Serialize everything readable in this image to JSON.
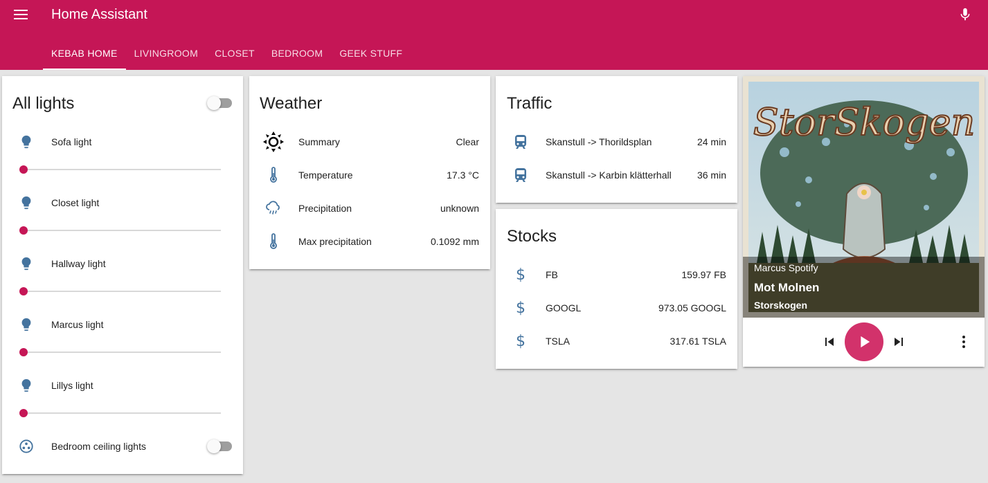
{
  "app": {
    "title": "Home Assistant"
  },
  "tabs": [
    {
      "label": "KEBAB HOME",
      "active": true
    },
    {
      "label": "LIVINGROOM"
    },
    {
      "label": "CLOSET"
    },
    {
      "label": "BEDROOM"
    },
    {
      "label": "GEEK STUFF"
    }
  ],
  "colors": {
    "accent": "#c51656",
    "icon": "#44739e",
    "background": "#e5e5e5"
  },
  "lights": {
    "title": "All lights",
    "items": [
      {
        "label": "Sofa light",
        "icon": "lightbulb-icon",
        "brightness": 0
      },
      {
        "label": "Closet light",
        "icon": "lightbulb-icon",
        "brightness": 0
      },
      {
        "label": "Hallway light",
        "icon": "lightbulb-icon",
        "brightness": 0
      },
      {
        "label": "Marcus light",
        "icon": "lightbulb-icon",
        "brightness": 0
      },
      {
        "label": "Lillys light",
        "icon": "lightbulb-icon",
        "brightness": 0
      }
    ],
    "group": {
      "label": "Bedroom ceiling lights",
      "icon": "lights-group-icon",
      "on": false
    }
  },
  "weather": {
    "title": "Weather",
    "rows": [
      {
        "label": "Summary",
        "value": "Clear",
        "icon": "sun-icon"
      },
      {
        "label": "Temperature",
        "value": "17.3 °C",
        "icon": "thermometer-icon"
      },
      {
        "label": "Precipitation",
        "value": "unknown",
        "icon": "rain-cloud-icon"
      },
      {
        "label": "Max precipitation",
        "value": "0.1092 mm",
        "icon": "thermometer-icon"
      }
    ]
  },
  "traffic": {
    "title": "Traffic",
    "rows": [
      {
        "label": "Skanstull -> Thorildsplan",
        "value": "24 min",
        "icon": "train-icon"
      },
      {
        "label": "Skanstull -> Karbin klätterhall",
        "value": "36 min",
        "icon": "train-icon"
      }
    ]
  },
  "stocks": {
    "title": "Stocks",
    "rows": [
      {
        "label": "FB",
        "value": "159.97 FB",
        "icon": "dollar-icon"
      },
      {
        "label": "GOOGL",
        "value": "973.05 GOOGL",
        "icon": "dollar-icon"
      },
      {
        "label": "TSLA",
        "value": "317.61 TSLA",
        "icon": "dollar-icon"
      }
    ]
  },
  "media": {
    "source": "Marcus Spotify",
    "track": "Mot Molnen",
    "artist": "Storskogen",
    "art_text": "StorSkogen"
  }
}
